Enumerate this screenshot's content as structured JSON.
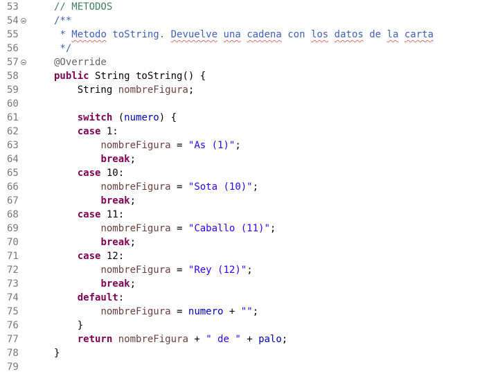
{
  "editor": {
    "lines": [
      {
        "num": "53",
        "text": "// METODOS"
      },
      {
        "num": "54",
        "text": "/**"
      },
      {
        "num": "55",
        "text": " * Metodo toString. Devuelve una cadena con los datos de la carta"
      },
      {
        "num": "56",
        "text": " */"
      },
      {
        "num": "57",
        "text": "@Override"
      },
      {
        "num": "58",
        "text": "public String toString() {"
      },
      {
        "num": "59",
        "text": "    String nombreFigura;"
      },
      {
        "num": "60",
        "text": ""
      },
      {
        "num": "61",
        "text": "    switch (numero) {"
      },
      {
        "num": "62",
        "text": "    case 1:"
      },
      {
        "num": "63",
        "text": "        nombreFigura = \"As (1)\";"
      },
      {
        "num": "64",
        "text": "        break;"
      },
      {
        "num": "65",
        "text": "    case 10:"
      },
      {
        "num": "66",
        "text": "        nombreFigura = \"Sota (10)\";"
      },
      {
        "num": "67",
        "text": "        break;"
      },
      {
        "num": "68",
        "text": "    case 11:"
      },
      {
        "num": "69",
        "text": "        nombreFigura = \"Caballo (11)\";"
      },
      {
        "num": "70",
        "text": "        break;"
      },
      {
        "num": "71",
        "text": "    case 12:"
      },
      {
        "num": "72",
        "text": "        nombreFigura = \"Rey (12)\";"
      },
      {
        "num": "73",
        "text": "        break;"
      },
      {
        "num": "74",
        "text": "    default:"
      },
      {
        "num": "75",
        "text": "        nombreFigura = numero + \"\";"
      },
      {
        "num": "76",
        "text": "    }"
      },
      {
        "num": "77",
        "text": "    return nombreFigura + \" de \" + palo;"
      },
      {
        "num": "78",
        "text": "}"
      },
      {
        "num": "79",
        "text": ""
      }
    ],
    "fold_markers": [
      "54",
      "57"
    ],
    "colors": {
      "keyword": "#7f0055",
      "comment": "#3f7f5f",
      "javadoc": "#3f5fbf",
      "string": "#2a00ff",
      "field": "#0000c0",
      "annotation": "#646464",
      "local_variable": "#6a3e3e",
      "line_number": "#787878",
      "spellcheck_underline": "#e06c6c"
    },
    "icons": {
      "fold": "fold-collapse-icon"
    }
  }
}
